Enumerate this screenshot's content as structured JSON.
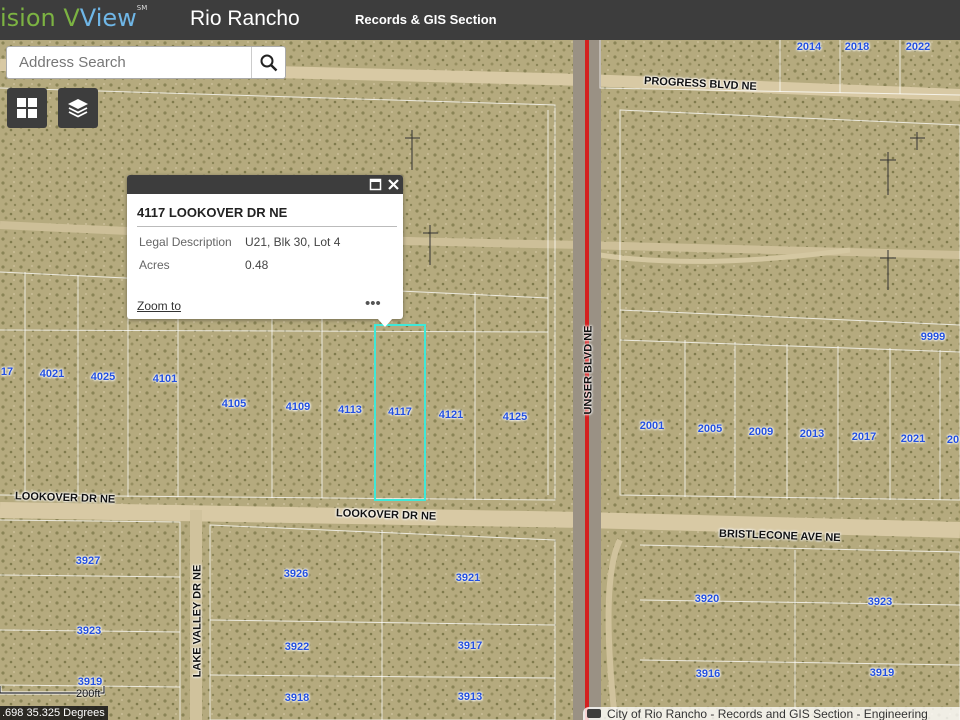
{
  "header": {
    "logo_left": "ision ",
    "logo_v": "V",
    "logo_right": "View",
    "logo_sm": "SM",
    "app_title": "Rio Rancho",
    "section_title": "Records & GIS Section"
  },
  "search": {
    "placeholder": "Address Search"
  },
  "icons": {
    "search": "search-icon",
    "basemap": "grid-icon",
    "layers": "layers-icon",
    "maximize": "maximize-icon",
    "close": "close-icon"
  },
  "popup": {
    "title": "4117 LOOKOVER DR NE",
    "rows": [
      {
        "label": "Legal Description",
        "value": "U21, Blk 30, Lot 4"
      },
      {
        "label": "Acres",
        "value": "0.48"
      }
    ],
    "zoom_to": "Zoom to",
    "more": "•••"
  },
  "streets": {
    "progress": "PROGRESS BLVD NE",
    "lookover_w": "LOOKOVER DR NE",
    "lookover_c": "LOOKOVER DR NE",
    "bristlecone": "BRISTLECONE AVE NE",
    "unser": "UNSER BLVD NE",
    "lake_valley": "LAKE VALLEY DR NE"
  },
  "parcels": {
    "p2014": "2014",
    "p2018": "2018",
    "p2022": "2022",
    "p17": "17",
    "p4021": "4021",
    "p4025": "4025",
    "p4101": "4101",
    "p4105": "4105",
    "p4109": "4109",
    "p4113": "4113",
    "p4117": "4117",
    "p4121": "4121",
    "p4125": "4125",
    "p9999": "9999",
    "p2001": "2001",
    "p2005": "2005",
    "p2009": "2009",
    "p2013": "2013",
    "p2017": "2017",
    "p2021": "2021",
    "p20": "20",
    "p3927": "3927",
    "p3926": "3926",
    "p3921": "3921",
    "p3923w": "3923",
    "p3922": "3922",
    "p3917": "3917",
    "p3919": "3919",
    "p3918": "3918",
    "p3913": "3913",
    "p3920": "3920",
    "p3923e": "3923",
    "p3916": "3916",
    "p3919e": "3919"
  },
  "scale_label": "200ft",
  "coordinates": ".698 35.325 Degrees",
  "attribution": "City of Rio Rancho - Records and GIS Section - Engineering",
  "colors": {
    "header": "#3d3d3d",
    "parcel_label": "#2350e0",
    "highlight": "#3fe8d8",
    "road_center": "#d42020"
  }
}
